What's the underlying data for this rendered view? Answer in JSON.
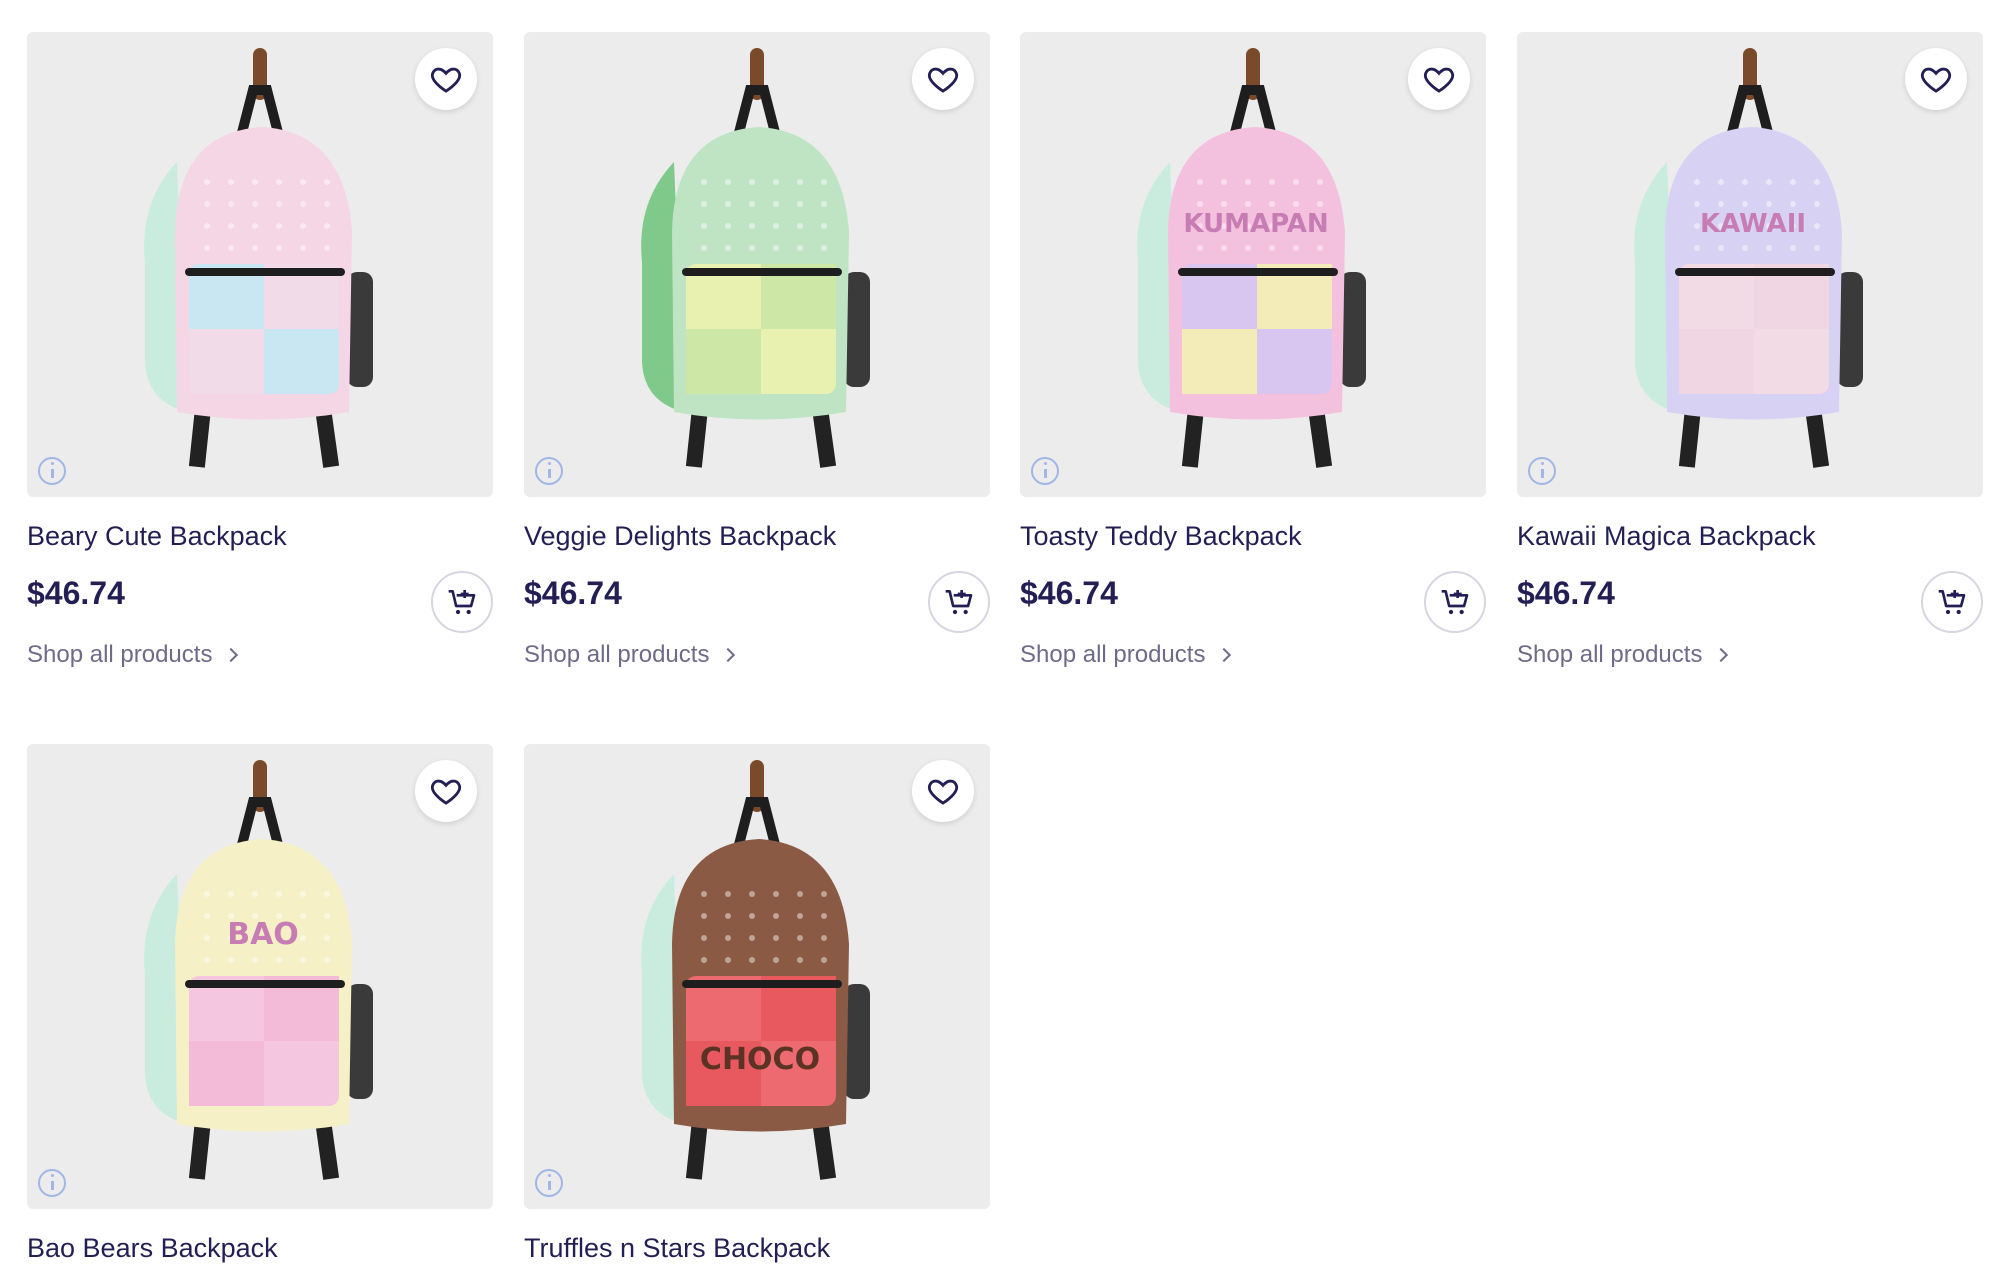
{
  "products": [
    {
      "title": "Beary Cute Backpack",
      "price": "$46.74",
      "shop_link": "Shop all products",
      "colors": {
        "main": "#f5d6e4",
        "side": "#c9ecdf",
        "pocket_a": "#c9e6f3",
        "pocket_b": "#f2dbe8"
      }
    },
    {
      "title": "Veggie Delights Backpack",
      "price": "$46.74",
      "shop_link": "Shop all products",
      "colors": {
        "main": "#bfe4c4",
        "side": "#7fc98a",
        "pocket_a": "#e8f1b0",
        "pocket_b": "#cde8a6"
      }
    },
    {
      "title": "Toasty Teddy Backpack",
      "price": "$46.74",
      "shop_link": "Shop all products",
      "colors": {
        "main": "#f3c1dd",
        "side": "#c9ecdf",
        "pocket_a": "#d9c6f0",
        "pocket_b": "#f3ecb8"
      },
      "print_text": "KUMAPAN"
    },
    {
      "title": "Kawaii Magica Backpack",
      "price": "$46.74",
      "shop_link": "Shop all products",
      "colors": {
        "main": "#d7d2f3",
        "side": "#c9ecdf",
        "pocket_a": "#f3dbe5",
        "pocket_b": "#f0d6e2"
      },
      "print_text": "KAWAII"
    },
    {
      "title": "Bao Bears Backpack",
      "price": "",
      "shop_link": "",
      "colors": {
        "main": "#f5f0c6",
        "side": "#c9ecdf",
        "pocket_a": "#f4c6e0",
        "pocket_b": "#f3bbd8"
      },
      "print_text": "BAO"
    },
    {
      "title": "Truffles n Stars Backpack",
      "price": "",
      "shop_link": "",
      "colors": {
        "main": "#8a5a45",
        "side": "#c9ecdf",
        "pocket_a": "#ec6a70",
        "pocket_b": "#e8585f"
      },
      "print_text": "CHOCO"
    }
  ],
  "icons": {
    "favorite": "heart-icon",
    "info": "info-icon",
    "cart": "add-to-cart-icon",
    "shop": "chevron-right-icon"
  }
}
